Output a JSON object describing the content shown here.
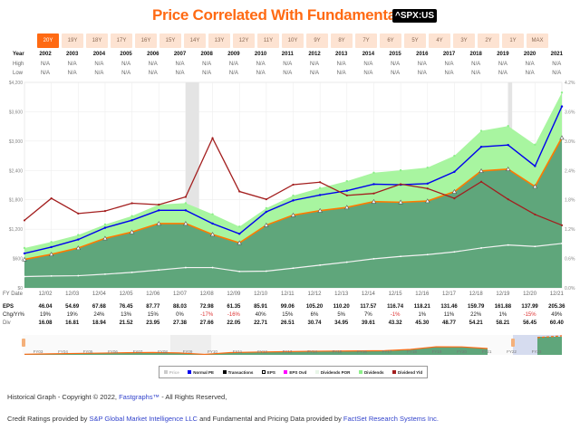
{
  "title": "Price Correlated With Fundamentals",
  "ticker": "^SPX:US",
  "range_buttons": [
    "20Y",
    "19Y",
    "18Y",
    "17Y",
    "16Y",
    "15Y",
    "14Y",
    "13Y",
    "12Y",
    "11Y",
    "10Y",
    "9Y",
    "8Y",
    "7Y",
    "6Y",
    "5Y",
    "4Y",
    "3Y",
    "2Y",
    "1Y",
    "MAX"
  ],
  "active_range": "20Y",
  "header_table": {
    "year_label": "Year",
    "high_label": "High",
    "low_label": "Low",
    "years": [
      "2002",
      "2003",
      "2004",
      "2005",
      "2006",
      "2007",
      "2008",
      "2009",
      "2010",
      "2011",
      "2012",
      "2013",
      "2014",
      "2015",
      "2016",
      "2017",
      "2018",
      "2019",
      "2020",
      "2021"
    ],
    "high": [
      "N/A",
      "N/A",
      "N/A",
      "N/A",
      "N/A",
      "N/A",
      "N/A",
      "N/A",
      "N/A",
      "N/A",
      "N/A",
      "N/A",
      "N/A",
      "N/A",
      "N/A",
      "N/A",
      "N/A",
      "N/A",
      "N/A",
      "N/A"
    ],
    "low": [
      "N/A",
      "N/A",
      "N/A",
      "N/A",
      "N/A",
      "N/A",
      "N/A",
      "N/A",
      "N/A",
      "N/A",
      "N/A",
      "N/A",
      "N/A",
      "N/A",
      "N/A",
      "N/A",
      "N/A",
      "N/A",
      "N/A",
      "N/A"
    ]
  },
  "chart_data": {
    "type": "area",
    "title": "Price Correlated With Fundamentals",
    "x": [
      "12/02",
      "12/03",
      "12/04",
      "12/05",
      "12/06",
      "12/07",
      "12/08",
      "12/09",
      "12/10",
      "12/11",
      "12/12",
      "12/13",
      "12/14",
      "12/15",
      "12/16",
      "12/17",
      "12/18",
      "12/19",
      "12/20",
      "12/21"
    ],
    "left_axis": {
      "ticks": [
        "$0",
        "$600",
        "$1,200",
        "$1,800",
        "$2,400",
        "$3,000",
        "$3,600",
        "$4,200"
      ],
      "range": [
        0,
        4200
      ]
    },
    "right_axis": {
      "ticks": [
        "0.0%",
        "0.6%",
        "1.2%",
        "1.8%",
        "2.4%",
        "3.0%",
        "3.6%",
        "4.2%"
      ],
      "range": [
        0,
        4.2
      ]
    },
    "recessions": [
      [
        2008.0,
        2008.5
      ],
      [
        2020.0,
        2020.15
      ]
    ],
    "series": [
      {
        "name": "Dividends",
        "color": "#a8f5a0",
        "values": [
          815,
          938,
          1080,
          1295,
          1468,
          1702,
          1732,
          1505,
          1252,
          1628,
          1886,
          2040,
          2181,
          2354,
          2403,
          2458,
          2698,
          3209,
          3308,
          2926,
          3991
        ]
      },
      {
        "name": "EPS",
        "color": "#ff7a00",
        "values": [
          582,
          686,
          815,
          1012,
          1141,
          1314,
          1314,
          1092,
          920,
          1283,
          1486,
          1578,
          1646,
          1763,
          1751,
          1775,
          1966,
          2391,
          2428,
          2071,
          3068
        ]
      },
      {
        "name": "Normal PE",
        "color": "#0000ee",
        "values": [
          705,
          834,
          988,
          1228,
          1382,
          1585,
          1585,
          1314,
          1105,
          1554,
          1788,
          1898,
          1985,
          2120,
          2108,
          2132,
          2372,
          2883,
          2920,
          2489,
          3708
        ]
      },
      {
        "name": "Dividends POR",
        "color": "#f2f2f2",
        "values": [
          231,
          243,
          249,
          280,
          317,
          366,
          415,
          415,
          335,
          342,
          403,
          465,
          526,
          594,
          643,
          680,
          735,
          815,
          877,
          846,
          908
        ]
      },
      {
        "name": "Dividend Yld",
        "color": "#a31e1e",
        "axis": "right",
        "values": [
          1.38,
          1.83,
          1.52,
          1.57,
          1.73,
          1.7,
          1.86,
          3.06,
          1.97,
          1.81,
          2.11,
          2.16,
          1.89,
          1.93,
          2.12,
          2.03,
          1.83,
          2.17,
          1.81,
          1.5,
          1.28
        ]
      }
    ]
  },
  "bottom_table": {
    "fy_label": "FY Date",
    "eps_label": "EPS",
    "chg_label": "Chg/Yr%",
    "div_label": "Div",
    "fy": [
      "12/02",
      "12/03",
      "12/04",
      "12/05",
      "12/06",
      "12/07",
      "12/08",
      "12/09",
      "12/10",
      "12/11",
      "12/12",
      "12/13",
      "12/14",
      "12/15",
      "12/16",
      "12/17",
      "12/18",
      "12/19",
      "12/20",
      "12/21"
    ],
    "eps": [
      "46.04",
      "54.69",
      "67.68",
      "76.45",
      "87.77",
      "88.03",
      "72.98",
      "61.35",
      "85.91",
      "99.06",
      "105.20",
      "110.20",
      "117.57",
      "116.74",
      "118.21",
      "131.46",
      "159.79",
      "161.88",
      "137.99",
      "205.36"
    ],
    "chg": [
      "19%",
      "19%",
      "24%",
      "13%",
      "15%",
      "0%",
      "-17%",
      "-16%",
      "40%",
      "15%",
      "6%",
      "5%",
      "7%",
      "-1%",
      "1%",
      "11%",
      "22%",
      "1%",
      "-15%",
      "49%"
    ],
    "div": [
      "16.08",
      "16.81",
      "18.94",
      "21.52",
      "23.95",
      "27.38",
      "27.66",
      "22.05",
      "22.71",
      "26.51",
      "30.74",
      "34.95",
      "39.61",
      "43.32",
      "45.30",
      "48.77",
      "54.21",
      "58.21",
      "56.45",
      "60.40"
    ]
  },
  "navigator": {
    "labels": [
      "FY03",
      "FY04",
      "FY05",
      "FY06",
      "FY07",
      "FY08",
      "FY09",
      "FY10",
      "FY11",
      "FY12",
      "FY13",
      "FY14",
      "FY15",
      "FY16",
      "FY17",
      "FY18",
      "FY19",
      "FY20",
      "FY21",
      "FY22",
      "FY23"
    ]
  },
  "legend": [
    {
      "label": "Price",
      "color": "#cccccc"
    },
    {
      "label": "Normal PE",
      "color": "#0000ee"
    },
    {
      "label": "Transactions",
      "color": "#000000"
    },
    {
      "label": "EPS",
      "color": "#ffffff"
    },
    {
      "label": "EPS Ovd",
      "color": "#ff00ff"
    },
    {
      "label": "Dividends POR",
      "color": "#e8f5e8"
    },
    {
      "label": "Dividends",
      "color": "#8ef08a"
    },
    {
      "label": "Dividend Yld",
      "color": "#a31e1e"
    }
  ],
  "footer": {
    "line1_a": "Historical Graph - Copyright © 2022, ",
    "line1_link": "Fastgraphs™",
    "line1_b": " - All Rights Reserved,",
    "line2_a": "Credit Ratings provided by ",
    "line2_link1": "S&P Global Market Intelligence LLC",
    "line2_b": " and Fundamental and Pricing Data provided by ",
    "line2_link2": "FactSet Research Systems Inc."
  }
}
